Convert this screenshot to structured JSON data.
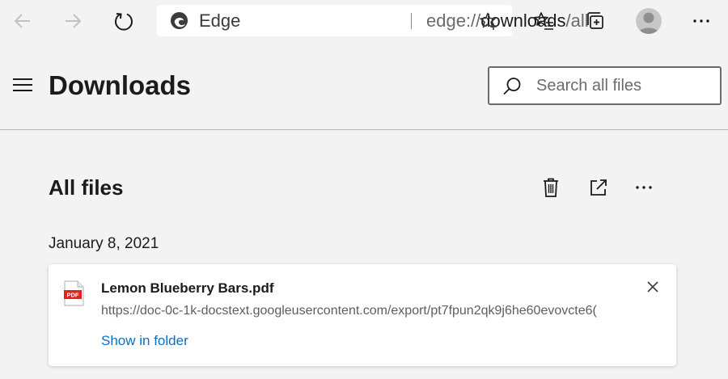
{
  "browser": {
    "address_site": "Edge",
    "address_url_scheme": "edge://",
    "address_url_host": "downloads",
    "address_url_path": "/all"
  },
  "page": {
    "title": "Downloads",
    "search_placeholder": "Search all files"
  },
  "section": {
    "title": "All files"
  },
  "downloads": {
    "date": "January 8, 2021",
    "items": [
      {
        "file_type_badge": "PDF",
        "name": "Lemon Blueberry Bars.pdf",
        "url": "https://doc-0c-1k-docstext.googleusercontent.com/export/pt7fpun2qk9j6he60evovcte6(",
        "action_label": "Show in folder"
      }
    ]
  },
  "icons": {
    "back": "back-arrow-icon",
    "forward": "forward-arrow-icon",
    "refresh": "refresh-icon",
    "favorite": "star-add-icon",
    "favorites": "favorites-list-icon",
    "collections": "collections-icon",
    "profile": "profile-avatar-icon",
    "more": "more-icon",
    "menu": "hamburger-menu-icon",
    "search": "search-icon",
    "delete": "trash-icon",
    "open_external": "open-external-icon",
    "close": "close-icon"
  },
  "colors": {
    "link": "#0b6fc6",
    "pdf_badge": "#e2231a",
    "background": "#f3f3f3"
  }
}
